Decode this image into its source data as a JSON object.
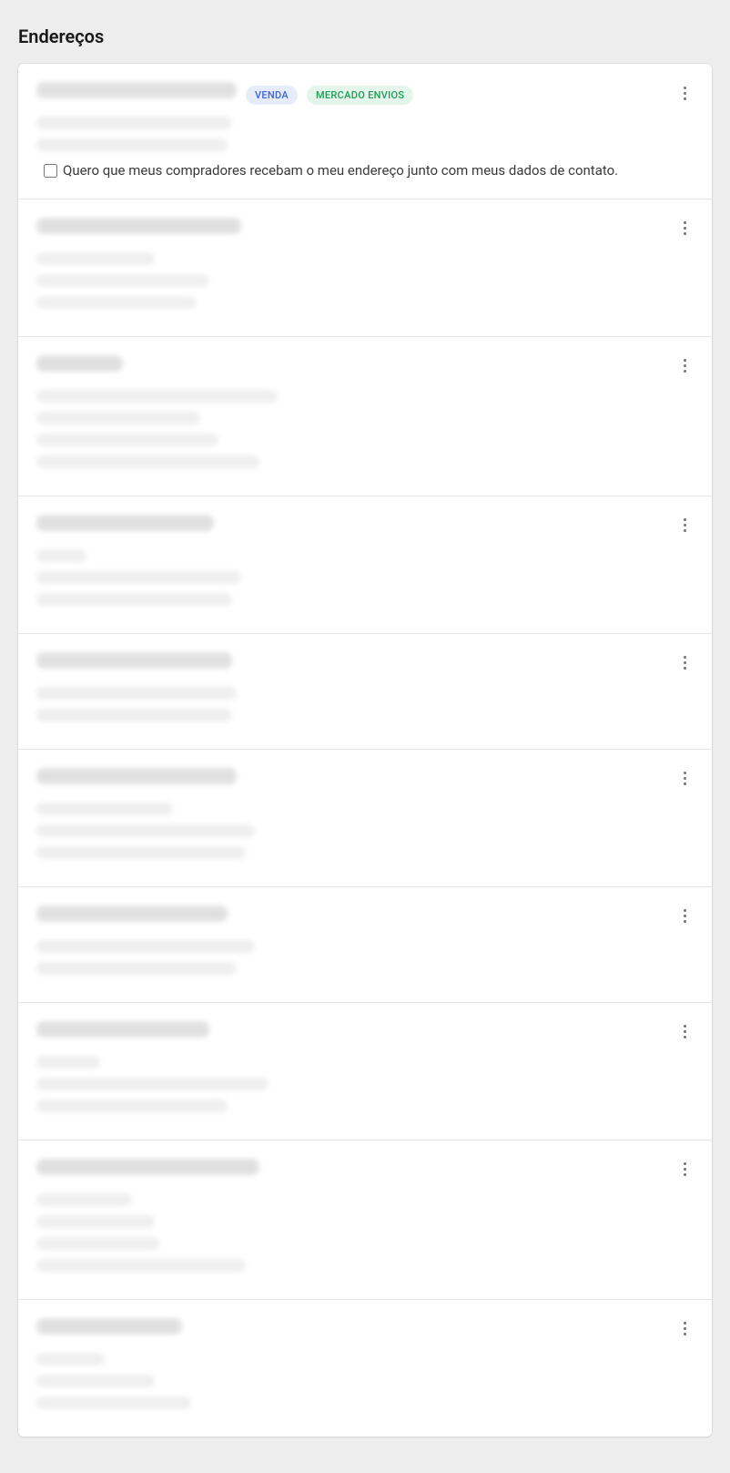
{
  "page": {
    "title": "Endereços"
  },
  "badges": {
    "venda": "VENDA",
    "mercado_envios": "MERCADO ENVIOS"
  },
  "consent": {
    "label": "Quero que meus compradores recebam o meu endereço junto com meus dados de contato.",
    "checked": false
  },
  "addresses": [
    {
      "title_width": 220,
      "lines": [
        215,
        210
      ],
      "badges": [
        "venda",
        "mercado_envios"
      ],
      "show_consent": true
    },
    {
      "title_width": 225,
      "lines": [
        130,
        190,
        175
      ],
      "badges": [],
      "show_consent": false
    },
    {
      "title_width": 95,
      "lines": [
        265,
        180,
        200,
        245
      ],
      "badges": [],
      "show_consent": false
    },
    {
      "title_width": 195,
      "lines": [
        55,
        225,
        215
      ],
      "badges": [],
      "show_consent": false
    },
    {
      "title_width": 215,
      "lines": [
        220,
        215
      ],
      "badges": [],
      "show_consent": false
    },
    {
      "title_width": 220,
      "lines": [
        150,
        240,
        230
      ],
      "badges": [],
      "show_consent": false
    },
    {
      "title_width": 210,
      "lines": [
        240,
        220
      ],
      "badges": [],
      "show_consent": false
    },
    {
      "title_width": 190,
      "lines": [
        70,
        255,
        210
      ],
      "badges": [],
      "show_consent": false
    },
    {
      "title_width": 245,
      "lines": [
        105,
        130,
        135,
        230
      ],
      "badges": [],
      "show_consent": false
    },
    {
      "title_width": 160,
      "lines": [
        75,
        130,
        170
      ],
      "badges": [],
      "show_consent": false
    }
  ]
}
